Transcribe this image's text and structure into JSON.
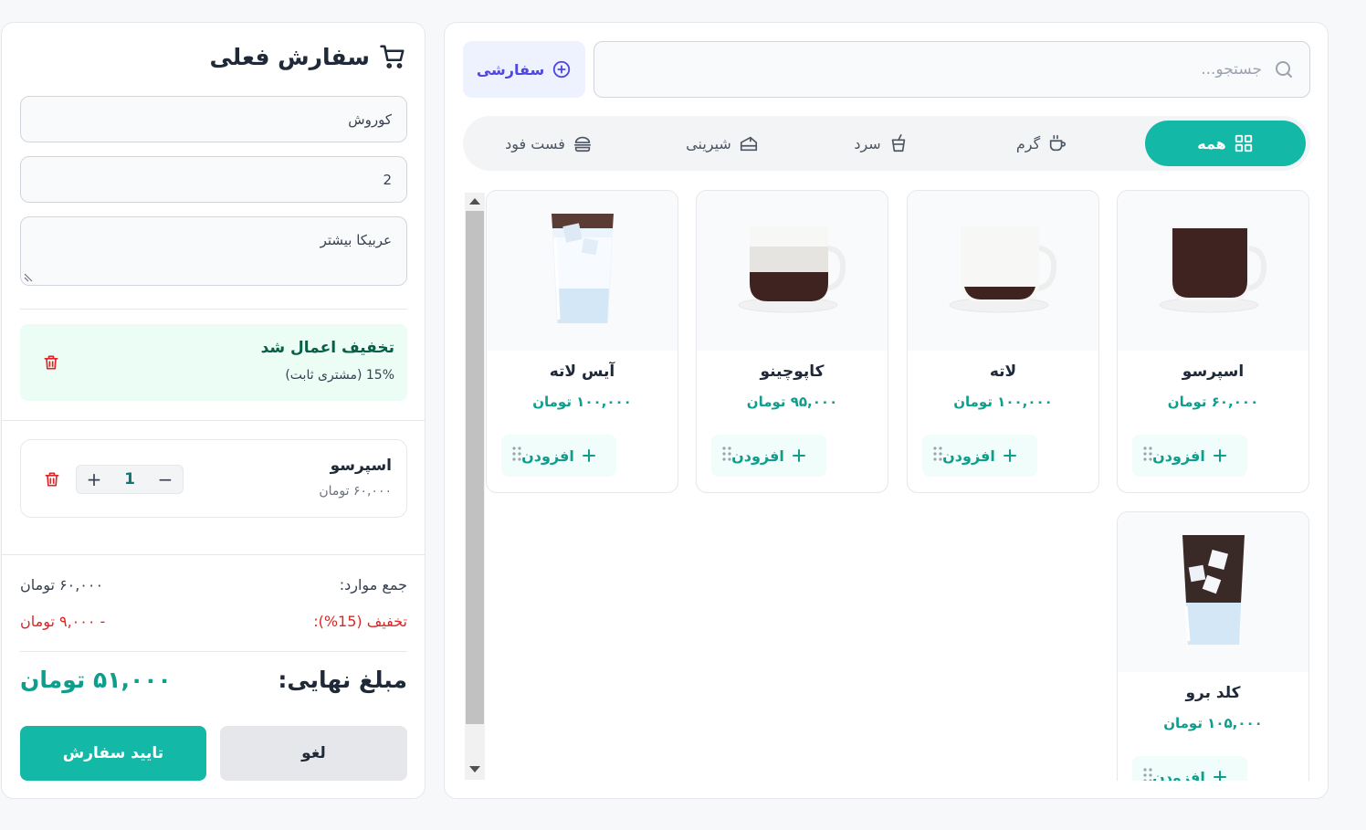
{
  "order": {
    "title": "سفارش فعلی",
    "customer_name": "کوروش",
    "table_number": "2",
    "note": "عربیکا بیشتر",
    "discount": {
      "title": "تخفیف اعمال شد",
      "detail": "15% (مشتری ثابت)"
    },
    "items": [
      {
        "name": "اسپرسو",
        "price": "۶۰,۰۰۰ تومان",
        "qty": "1"
      }
    ],
    "subtotal_label": "جمع موارد:",
    "subtotal_value": "۶۰,۰۰۰ تومان",
    "discount_label": "تخفیف (15%):",
    "discount_value": "- ۹,۰۰۰ تومان",
    "final_label": "مبلغ نهایی:",
    "final_value": "۵۱,۰۰۰ تومان",
    "confirm_label": "تایید سفارش",
    "cancel_label": "لغو"
  },
  "menu": {
    "search_placeholder": "جستجو...",
    "custom_order_label": "سفارشی",
    "categories": [
      {
        "label": "همه",
        "icon": "grid-icon",
        "active": true
      },
      {
        "label": "گرم",
        "icon": "hot-cup-icon"
      },
      {
        "label": "سرد",
        "icon": "cold-cup-icon"
      },
      {
        "label": "شیرینی",
        "icon": "cake-icon"
      },
      {
        "label": "فست فود",
        "icon": "burger-icon"
      }
    ],
    "add_label": "افزودن",
    "products": [
      {
        "name": "اسپرسو",
        "price": "۶۰,۰۰۰ تومان",
        "image": "espresso-cup"
      },
      {
        "name": "لاته",
        "price": "۱۰۰,۰۰۰ تومان",
        "image": "latte-cup"
      },
      {
        "name": "کاپوچینو",
        "price": "۹۵,۰۰۰ تومان",
        "image": "cappuccino-cup"
      },
      {
        "name": "آیس لاته",
        "price": "۱۰۰,۰۰۰ تومان",
        "image": "iced-latte-glass"
      },
      {
        "name": "کلد برو",
        "price": "۱۰۵,۰۰۰ تومان",
        "image": "cold-brew-glass"
      }
    ]
  },
  "colors": {
    "accent": "#14b8a6",
    "accent_text": "#0f9e8c",
    "danger": "#dc2626",
    "indigo": "#4f46e5"
  }
}
